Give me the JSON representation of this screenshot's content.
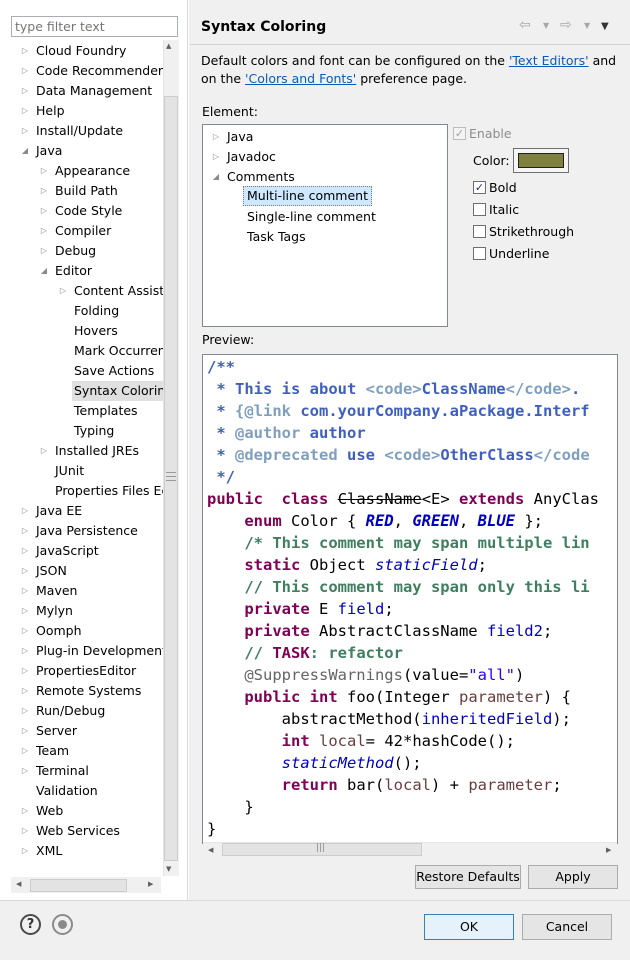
{
  "filter": {
    "placeholder": "type filter text"
  },
  "tree": {
    "items": [
      {
        "label": "Cloud Foundry",
        "twisty": "▷"
      },
      {
        "label": "Code Recommenders",
        "twisty": "▷"
      },
      {
        "label": "Data Management",
        "twisty": "▷"
      },
      {
        "label": "Help",
        "twisty": "▷"
      },
      {
        "label": "Install/Update",
        "twisty": "▷"
      },
      {
        "label": "Java",
        "twisty": "◢"
      },
      {
        "label": "Appearance",
        "twisty": "▷"
      },
      {
        "label": "Build Path",
        "twisty": "▷"
      },
      {
        "label": "Code Style",
        "twisty": "▷"
      },
      {
        "label": "Compiler",
        "twisty": "▷"
      },
      {
        "label": "Debug",
        "twisty": "▷"
      },
      {
        "label": "Editor",
        "twisty": "◢"
      },
      {
        "label": "Content Assist",
        "twisty": "▷"
      },
      {
        "label": "Folding",
        "twisty": ""
      },
      {
        "label": "Hovers",
        "twisty": ""
      },
      {
        "label": "Mark Occurren",
        "twisty": ""
      },
      {
        "label": "Save Actions",
        "twisty": ""
      },
      {
        "label": "Syntax Coloring",
        "twisty": ""
      },
      {
        "label": "Templates",
        "twisty": ""
      },
      {
        "label": "Typing",
        "twisty": ""
      },
      {
        "label": "Installed JREs",
        "twisty": "▷"
      },
      {
        "label": "JUnit",
        "twisty": ""
      },
      {
        "label": "Properties Files Ed",
        "twisty": ""
      },
      {
        "label": "Java EE",
        "twisty": "▷"
      },
      {
        "label": "Java Persistence",
        "twisty": "▷"
      },
      {
        "label": "JavaScript",
        "twisty": "▷"
      },
      {
        "label": "JSON",
        "twisty": "▷"
      },
      {
        "label": "Maven",
        "twisty": "▷"
      },
      {
        "label": "Mylyn",
        "twisty": "▷"
      },
      {
        "label": "Oomph",
        "twisty": "▷"
      },
      {
        "label": "Plug-in Development",
        "twisty": "▷"
      },
      {
        "label": "PropertiesEditor",
        "twisty": "▷"
      },
      {
        "label": "Remote Systems",
        "twisty": "▷"
      },
      {
        "label": "Run/Debug",
        "twisty": "▷"
      },
      {
        "label": "Server",
        "twisty": "▷"
      },
      {
        "label": "Team",
        "twisty": "▷"
      },
      {
        "label": "Terminal",
        "twisty": "▷"
      },
      {
        "label": "Validation",
        "twisty": ""
      },
      {
        "label": "Web",
        "twisty": "▷"
      },
      {
        "label": "Web Services",
        "twisty": "▷"
      },
      {
        "label": "XML",
        "twisty": "▷"
      }
    ],
    "selected": "Syntax Coloring"
  },
  "header": {
    "title": "Syntax Coloring",
    "nav_icons": [
      "back-arrow-icon",
      "forward-arrow-icon",
      "view-menu-icon"
    ]
  },
  "description": {
    "part1": "Default colors and font can be configured on the ",
    "link1": "'Text Editors'",
    "part2": " and on the ",
    "link2": "'Colors and Fonts'",
    "part3": " preference page."
  },
  "element": {
    "label": "Element:",
    "nodes": [
      {
        "label": "Java",
        "twisty": "▷"
      },
      {
        "label": "Javadoc",
        "twisty": "▷"
      },
      {
        "label": "Comments",
        "twisty": "◢"
      },
      {
        "label": "Multi-line comment",
        "twisty": ""
      },
      {
        "label": "Single-line comment",
        "twisty": ""
      },
      {
        "label": "Task Tags",
        "twisty": ""
      }
    ]
  },
  "options": {
    "enable": {
      "label": "Enable",
      "checked": true,
      "disabled": true
    },
    "color_label": "Color:",
    "color_value": "#808040",
    "bold": {
      "label": "Bold",
      "checked": true
    },
    "italic": {
      "label": "Italic",
      "checked": false
    },
    "strikethrough": {
      "label": "Strikethrough",
      "checked": false
    },
    "underline": {
      "label": "Underline",
      "checked": false
    }
  },
  "preview": {
    "label": "Preview:",
    "lines": [
      [
        [
          "jd",
          "/**"
        ]
      ],
      [
        [
          "jd",
          " * This is about "
        ],
        [
          "jdt",
          "<code>"
        ],
        [
          "jd",
          "ClassName"
        ],
        [
          "jdt",
          "</code>"
        ],
        [
          "jd",
          "."
        ]
      ],
      [
        [
          "jd",
          " * "
        ],
        [
          "jdt",
          "{@link"
        ],
        [
          "jd",
          " com.yourCompany.aPackage.Interf"
        ]
      ],
      [
        [
          "jd",
          " * "
        ],
        [
          "jdt",
          "@author"
        ],
        [
          "jd",
          " author"
        ]
      ],
      [
        [
          "jd",
          " * "
        ],
        [
          "jdt",
          "@deprecated"
        ],
        [
          "jd",
          " use "
        ],
        [
          "jdt",
          "<code>"
        ],
        [
          "jd",
          "OtherClass"
        ],
        [
          "jdt",
          "</code"
        ]
      ],
      [
        [
          "jd",
          " */"
        ]
      ],
      [
        [
          "kw",
          "public"
        ],
        [
          "",
          "  "
        ],
        [
          "kw",
          "class"
        ],
        [
          "",
          " "
        ],
        [
          "strike",
          "ClassName"
        ],
        [
          "",
          "<E> "
        ],
        [
          "kw",
          "extends"
        ],
        [
          "",
          " AnyClas"
        ]
      ],
      [
        [
          "",
          "    "
        ],
        [
          "kw",
          "enum"
        ],
        [
          "",
          " Color { "
        ],
        [
          "stf",
          "RED"
        ],
        [
          "",
          ", "
        ],
        [
          "stf",
          "GREEN"
        ],
        [
          "",
          ", "
        ],
        [
          "stf",
          "BLUE"
        ],
        [
          "",
          " };"
        ]
      ],
      [
        [
          "",
          "    "
        ],
        [
          "cm",
          "/* This comment may span multiple lin"
        ]
      ],
      [
        [
          "",
          "    "
        ],
        [
          "kw",
          "static"
        ],
        [
          "",
          " Object "
        ],
        [
          "st",
          "staticField"
        ],
        [
          "",
          ";"
        ]
      ],
      [
        [
          "",
          "    "
        ],
        [
          "cm",
          "// This comment may span only this li"
        ]
      ],
      [
        [
          "",
          "    "
        ],
        [
          "kw",
          "private"
        ],
        [
          "",
          " E "
        ],
        [
          "fld",
          "field"
        ],
        [
          "",
          ";"
        ]
      ],
      [
        [
          "",
          "    "
        ],
        [
          "kw",
          "private"
        ],
        [
          "",
          " AbstractClassName "
        ],
        [
          "fld",
          "field2"
        ],
        [
          "",
          ";"
        ]
      ],
      [
        [
          "",
          "    "
        ],
        [
          "cm",
          "// "
        ],
        [
          "kw",
          "TASK"
        ],
        [
          "cm",
          ": refactor"
        ]
      ],
      [
        [
          "",
          "    "
        ],
        [
          "ann",
          "@SuppressWarnings"
        ],
        [
          "",
          "(value="
        ],
        [
          "str",
          "\"all\""
        ],
        [
          "",
          ")"
        ]
      ],
      [
        [
          "",
          "    "
        ],
        [
          "kw",
          "public"
        ],
        [
          "",
          " "
        ],
        [
          "kw",
          "int"
        ],
        [
          "",
          " foo(Integer "
        ],
        [
          "par",
          "parameter"
        ],
        [
          "",
          ") {"
        ]
      ],
      [
        [
          "",
          "        abstractMethod("
        ],
        [
          "fld",
          "inheritedField"
        ],
        [
          "",
          ");"
        ]
      ],
      [
        [
          "",
          "        "
        ],
        [
          "kw",
          "int"
        ],
        [
          "",
          " "
        ],
        [
          "par",
          "local"
        ],
        [
          "",
          "= 42*hashCode();"
        ]
      ],
      [
        [
          "",
          "        "
        ],
        [
          "sti",
          "staticMethod"
        ],
        [
          "",
          "();"
        ]
      ],
      [
        [
          "",
          "        "
        ],
        [
          "kw",
          "return"
        ],
        [
          "",
          " bar("
        ],
        [
          "par",
          "local"
        ],
        [
          "",
          ") + "
        ],
        [
          "par",
          "parameter"
        ],
        [
          "",
          ";"
        ]
      ],
      [
        [
          "",
          "    }"
        ]
      ],
      [
        [
          "",
          "}"
        ]
      ]
    ]
  },
  "buttons": {
    "restore": "Restore Defaults",
    "apply": "Apply",
    "ok": "OK",
    "cancel": "Cancel"
  },
  "footer_icons": [
    "help-icon",
    "import-export-icon"
  ]
}
